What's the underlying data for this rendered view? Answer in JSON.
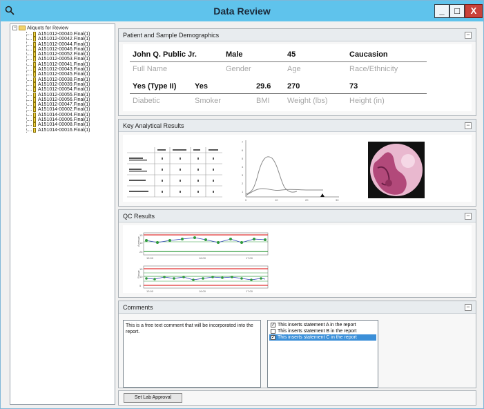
{
  "window": {
    "title": "Data Review",
    "min_label": "_",
    "max_label": "□",
    "close_label": "X"
  },
  "tree": {
    "root_label": "Aliquots for Review",
    "items": [
      "A151012-00040.Final(1)",
      "A151012-00042.Final(1)",
      "A151012-00044.Final(1)",
      "A151012-00046.Final(1)",
      "A151012-00052.Final(1)",
      "A151012-00053.Final(1)",
      "A151012-00041.Final(1)",
      "A151012-00043.Final(1)",
      "A151012-00045.Final(1)",
      "A151012-00038.Final(1)",
      "A151012-00039.Final(1)",
      "A151012-00054.Final(1)",
      "A151012-00055.Final(1)",
      "A151012-00056.Final(1)",
      "A151012-00047.Final(1)",
      "A151014-00002.Final(1)",
      "A151014-00004.Final(1)",
      "A151014-00006.Final(1)",
      "A151014-00008.Final(1)",
      "A151014-00016.Final(1)"
    ]
  },
  "demographics": {
    "header": "Patient and Sample Demographics",
    "full_name": "John Q. Public Jr.",
    "full_name_label": "Full Name",
    "gender": "Male",
    "gender_label": "Gender",
    "age": "45",
    "age_label": "Age",
    "race": "Caucasion",
    "race_label": "Race/Ethnicity",
    "diabetic": "Yes (Type II)",
    "diabetic_label": "Diabetic",
    "smoker": "Yes",
    "smoker_label": "Smoker",
    "bmi": "29.6",
    "bmi_label": "BMI",
    "weight": "270",
    "weight_label": "Weight (lbs)",
    "height": "73",
    "height_label": "Height (in)"
  },
  "analytical": {
    "header": "Key Analytical Results"
  },
  "qc": {
    "header": "QC Results"
  },
  "comments": {
    "header": "Comments",
    "text": "This is a free text comment that will be incorporated into the report.",
    "statements": [
      {
        "label": "This inserts statement A in the report",
        "checked": true,
        "selected": false
      },
      {
        "label": "This inserts statement B in the report",
        "checked": false,
        "selected": false
      },
      {
        "label": "This inserts statement C in the report",
        "checked": true,
        "selected": true
      }
    ]
  },
  "approval": {
    "button_label": "Set Lab Approval"
  },
  "colors": {
    "titlebar": "#5fc3ec",
    "selection": "#3b8fd8",
    "qc_limit": "#e03030",
    "qc_target": "#2e9a3a",
    "qc_line": "#2b3fb5"
  }
}
